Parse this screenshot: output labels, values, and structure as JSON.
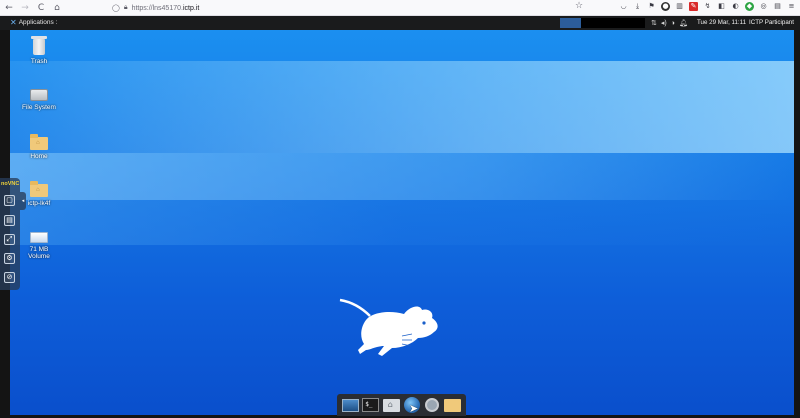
{
  "browser": {
    "url_prefix": "https://lns45170.",
    "url_domain": "ictp.it",
    "nav": {
      "back_icon": "←",
      "forward_icon": "→",
      "reload_icon": "C",
      "home_icon": "⌂"
    }
  },
  "remote_panel": {
    "applications_label": "Applications :",
    "clock": "Tue 29 Mar, 11:11",
    "user": "ICTP Participant"
  },
  "desktop_icons": [
    {
      "label": "Trash"
    },
    {
      "label": "File System"
    },
    {
      "label": "Home"
    },
    {
      "label": "ictp-lk4f"
    },
    {
      "label": "71 MB",
      "label2": "Volume"
    }
  ],
  "vnc": {
    "logo": "noVNC"
  },
  "colors": {
    "accent": "#1679e5",
    "panel": "#1a1b1c",
    "dock": "#2a2d33"
  }
}
